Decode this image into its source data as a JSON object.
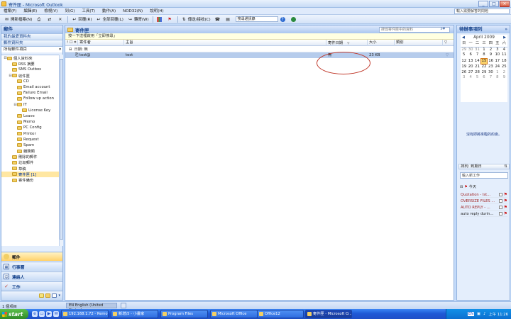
{
  "window": {
    "title": "寄件匣 - Microsoft Outlook"
  },
  "menu": {
    "items": [
      "檔案(F)",
      "編輯(E)",
      "檢視(V)",
      "到(G)",
      "工具(T)",
      "動作(A)",
      "NOD32(N)",
      "說明(H)"
    ],
    "help_placeholder": "輸入需要解答的問題"
  },
  "toolbar": {
    "new": "開新檔案(N)",
    "reply": "回覆(R)",
    "reply_all": "全部回覆(L)",
    "forward": "轉寄(W)",
    "send_receive": "傳送/接收(C)",
    "address_search": "搜尋通訊錄"
  },
  "nav": {
    "title": "郵件",
    "favorites_header": "我的最愛資料夾",
    "folders_header": "郵件資料夾",
    "all_items": "所有郵件項目",
    "folders": [
      {
        "label": "個人資料夾",
        "level": 0,
        "exp": "⊟"
      },
      {
        "label": "RSS 摘要",
        "level": 1,
        "exp": ""
      },
      {
        "label": "SMS Outbox",
        "level": 1,
        "exp": ""
      },
      {
        "label": "收件匣",
        "level": 1,
        "exp": "⊟"
      },
      {
        "label": "CD",
        "level": 2,
        "exp": ""
      },
      {
        "label": "Email account",
        "level": 2,
        "exp": ""
      },
      {
        "label": "Failure Email",
        "level": 2,
        "exp": ""
      },
      {
        "label": "Follow up action",
        "level": 2,
        "exp": ""
      },
      {
        "label": "IT",
        "level": 2,
        "exp": "⊟"
      },
      {
        "label": "License Key",
        "level": 3,
        "exp": ""
      },
      {
        "label": "Leave",
        "level": 2,
        "exp": ""
      },
      {
        "label": "Memo",
        "level": 2,
        "exp": ""
      },
      {
        "label": "PC Config",
        "level": 2,
        "exp": ""
      },
      {
        "label": "Printer",
        "level": 2,
        "exp": ""
      },
      {
        "label": "Request",
        "level": 2,
        "exp": ""
      },
      {
        "label": "Spam",
        "level": 2,
        "exp": ""
      },
      {
        "label": "雜務類",
        "level": 2,
        "exp": ""
      },
      {
        "label": "刪除的郵件",
        "level": 1,
        "exp": ""
      },
      {
        "label": "垃圾郵件",
        "level": 1,
        "exp": ""
      },
      {
        "label": "草稿",
        "level": 1,
        "exp": ""
      },
      {
        "label": "寄件匣 [1]",
        "level": 1,
        "exp": "",
        "selected": true
      },
      {
        "label": "寄件備份",
        "level": 1,
        "exp": ""
      }
    ],
    "buttons": [
      "郵件",
      "行事曆",
      "連絡人",
      "工作"
    ]
  },
  "main": {
    "title": "寄件匣",
    "search_placeholder": "搜尋寄件匣中的資料",
    "info": "按一下這裡啟用「立即搜尋」",
    "columns": [
      "寄件者",
      "主旨",
      "寄件日期",
      "大小",
      "類別"
    ],
    "group": "日期: 無",
    "row": {
      "from": "test@",
      "subject": "test",
      "date": "無",
      "size": "23 KB"
    }
  },
  "todo": {
    "title": "待辦事項列",
    "month": "April 2009",
    "weekdays": [
      "日",
      "一",
      "二",
      "三",
      "四",
      "五",
      "六"
    ],
    "weeks": [
      [
        "29",
        "30",
        "31",
        "1",
        "2",
        "3",
        "4"
      ],
      [
        "5",
        "6",
        "7",
        "8",
        "9",
        "10",
        "11"
      ],
      [
        "12",
        "13",
        "14",
        "15",
        "16",
        "17",
        "18"
      ],
      [
        "19",
        "20",
        "21",
        "22",
        "23",
        "24",
        "25"
      ],
      [
        "26",
        "27",
        "28",
        "29",
        "30",
        "1",
        "2"
      ],
      [
        "3",
        "4",
        "5",
        "6",
        "7",
        "8",
        "9"
      ]
    ],
    "no_appointments": "沒有即將來臨的約會。",
    "arrange": "排列: 到期日",
    "task_placeholder": "輸入新工作",
    "today_label": "今天",
    "tasks": [
      "Quotation - Ist...",
      "OVERSIZE FILES ...",
      "AUTO REPLY - ...",
      "auto reply durin..."
    ]
  },
  "status": {
    "items": "1 個項目",
    "language": "EN English (United States)"
  },
  "taskbar": {
    "start": "start",
    "buttons": [
      "192.168.1.72 - Remo...",
      "新增\\5 - 小畫家",
      "Program Files",
      "Microsoft Office",
      "Office12",
      "寄件匣 - Microsoft O..."
    ],
    "clock": "上午 11:26"
  },
  "colors": {
    "selected": "#b6ccec",
    "accent": "#15428b",
    "annotation": "#c0392b"
  }
}
